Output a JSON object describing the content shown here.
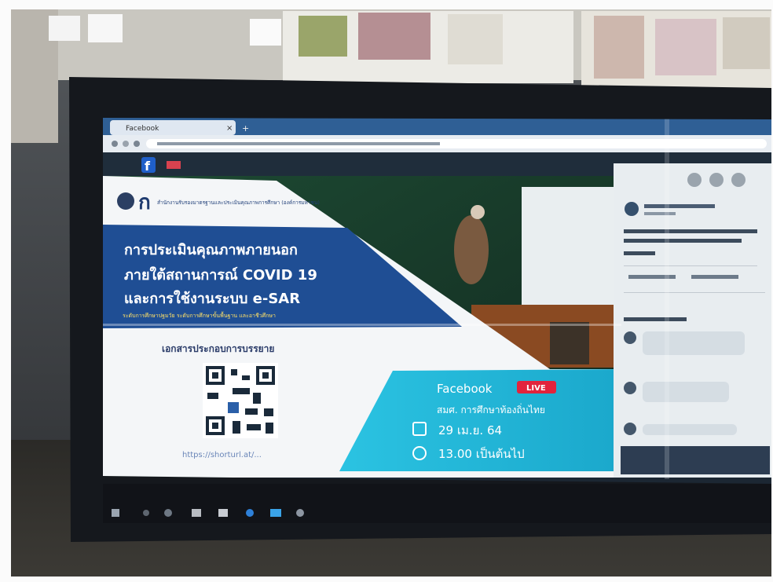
{
  "browser": {
    "tab_title": "Facebook",
    "close_glyph": "×",
    "new_tab_glyph": "+"
  },
  "banner": {
    "org_name": "สำนักงานรับรองมาตรฐานและประเมินคุณภาพการศึกษา (องค์การมหาชน)",
    "title_line1": "การประเมินคุณภาพภายนอก",
    "title_line2": "ภายใต้สถานการณ์ COVID 19",
    "title_line3": "และการใช้งานระบบ e-SAR",
    "subtitle": "ระดับการศึกษาปฐมวัย ระดับการศึกษาขั้นพื้นฐาน และอาชีวศึกษา",
    "docs_heading": "เอกสารประกอบการบรรยาย",
    "qr_caption": "https://shorturl.at/...",
    "live_platform": "Facebook",
    "live_badge": "LIVE",
    "live_page": "สมศ. การศึกษาท้องถิ่นไทย",
    "date_text": "29 เม.ย. 64",
    "time_text": "13.00 เป็นต้นไป"
  },
  "colors": {
    "banner_blue": "#1f4e94",
    "banner_cyan": "#2bb7d8",
    "live_red": "#e2233c",
    "fb_blue": "#1f5fc9",
    "screen_bezel": "#1a1d23"
  },
  "icons": [
    "facebook-icon",
    "calendar-icon",
    "clock-icon",
    "windows-start-icon",
    "edge-icon",
    "folder-icon",
    "chrome-icon"
  ]
}
